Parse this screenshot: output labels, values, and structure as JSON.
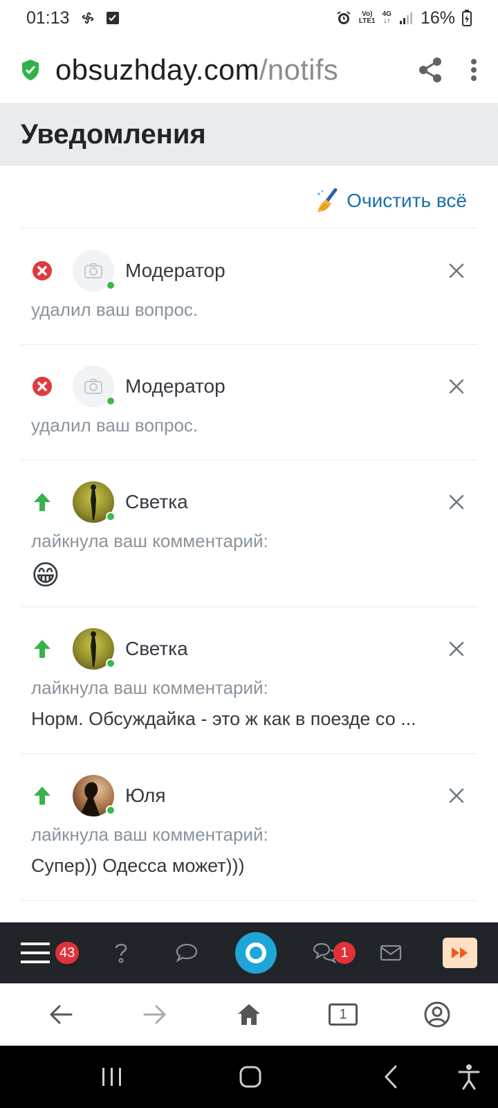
{
  "status_bar": {
    "time": "01:13",
    "network_top": "Vo)",
    "network_bottom": "LTE1",
    "signal_type": "4G",
    "battery": "16%"
  },
  "browser": {
    "url_domain": "obsuzhday.com",
    "url_path": "/notifs",
    "icons": [
      "shield-check-icon",
      "share-icon",
      "more-vert-icon"
    ]
  },
  "page": {
    "title": "Уведомления",
    "clear_all_label": "Очистить всё",
    "clear_all_icon": "broom-icon"
  },
  "notifications": [
    {
      "type": "deleted",
      "type_icon": "x-circle-icon",
      "user": "Модератор",
      "avatar": "camera-placeholder-icon",
      "action": "удалил ваш вопрос.",
      "snippet": ""
    },
    {
      "type": "deleted",
      "type_icon": "x-circle-icon",
      "user": "Модератор",
      "avatar": "camera-placeholder-icon",
      "action": "удалил ваш вопрос.",
      "snippet": ""
    },
    {
      "type": "like",
      "type_icon": "arrow-up-icon",
      "user": "Светка",
      "avatar": "photo",
      "action": "лайкнула ваш комментарий:",
      "snippet": "😁"
    },
    {
      "type": "like",
      "type_icon": "arrow-up-icon",
      "user": "Светка",
      "avatar": "photo",
      "action": "лайкнула ваш комментарий:",
      "snippet": "Норм. Обсуждайка - это ж как в поезде со ..."
    },
    {
      "type": "like",
      "type_icon": "arrow-up-icon",
      "user": "Юля",
      "avatar": "photo",
      "action": "лайкнула ваш комментарий:",
      "snippet": "Супер)) Одесса может)))"
    }
  ],
  "app_nav": {
    "menu_badge": "43",
    "messages_badge": "1"
  },
  "colors": {
    "accent_link": "#1a6fa8",
    "header_bg": "#e9ecef",
    "nav_bg": "#212428",
    "badge_red": "#e03238",
    "online_green": "#3bb84a",
    "logo_blue": "#1fa6d8"
  }
}
